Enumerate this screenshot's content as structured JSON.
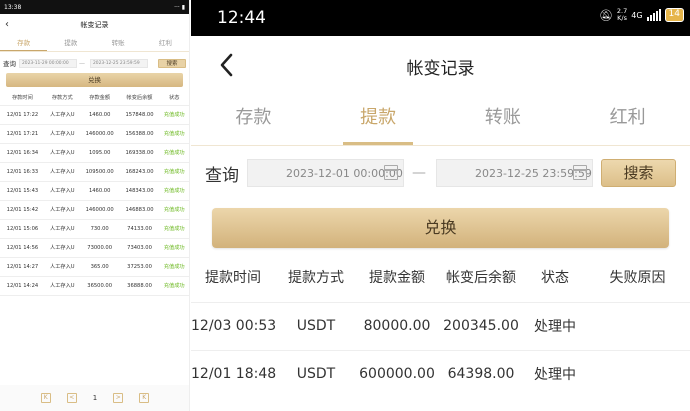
{
  "left": {
    "status": {
      "time": "13:38",
      "right": "··· ▮"
    },
    "title": "帐变记录",
    "tabs": [
      "存款",
      "提款",
      "转账",
      "红利"
    ],
    "query": {
      "label": "查询",
      "start": "2023-11-29 00:00:00",
      "end": "2023-12-25 23:59:59",
      "search": "搜索"
    },
    "exchange": "兑换",
    "columns": [
      "存款时间",
      "存款方式",
      "存款金额",
      "帐变后余额",
      "状态"
    ],
    "rows": [
      [
        "12/01 17:22",
        "人工存入U",
        "1460.00",
        "157848.00",
        "充值成功"
      ],
      [
        "12/01 17:21",
        "人工存入U",
        "146000.00",
        "156388.00",
        "充值成功"
      ],
      [
        "12/01 16:34",
        "人工存入U",
        "1095.00",
        "169338.00",
        "充值成功"
      ],
      [
        "12/01 16:33",
        "人工存入U",
        "109500.00",
        "168243.00",
        "充值成功"
      ],
      [
        "12/01 15:43",
        "人工存入U",
        "1460.00",
        "148343.00",
        "充值成功"
      ],
      [
        "12/01 15:42",
        "人工存入U",
        "146000.00",
        "146883.00",
        "充值成功"
      ],
      [
        "12/01 15:06",
        "人工存入U",
        "730.00",
        "74133.00",
        "充值成功"
      ],
      [
        "12/01 14:56",
        "人工存入U",
        "73000.00",
        "73403.00",
        "充值成功"
      ],
      [
        "12/01 14:27",
        "人工存入U",
        "365.00",
        "37253.00",
        "充值成功"
      ],
      [
        "12/01 14:24",
        "人工存入U",
        "36500.00",
        "36888.00",
        "充值成功"
      ]
    ],
    "pager": {
      "first": "K",
      "prev": "<",
      "page": "1",
      "next": ">",
      "last": "K"
    }
  },
  "right": {
    "status": {
      "time": "12:44",
      "net_speed": "2.7",
      "net_unit": "K/s",
      "net_type": "4G",
      "battery": "14"
    },
    "title": "帐变记录",
    "tabs": [
      "存款",
      "提款",
      "转账",
      "红利"
    ],
    "active_tab": "提款",
    "query": {
      "label": "查询",
      "start": "2023-12-01 00:00:00",
      "end": "2023-12-25 23:59:59",
      "search": "搜索"
    },
    "exchange": "兑换",
    "columns": [
      "提款时间",
      "提款方式",
      "提款金额",
      "帐变后余额",
      "状态",
      "失败原因"
    ],
    "rows": [
      [
        "12/03 00:53",
        "USDT",
        "80000.00",
        "200345.00",
        "处理中",
        ""
      ],
      [
        "12/01 18:48",
        "USDT",
        "600000.00",
        "64398.00",
        "处理中",
        ""
      ]
    ]
  },
  "colors": {
    "accent": "#c9a76b",
    "success": "#6bb81f",
    "processing": "#e2a224",
    "button_gold": "#dcbf89"
  }
}
